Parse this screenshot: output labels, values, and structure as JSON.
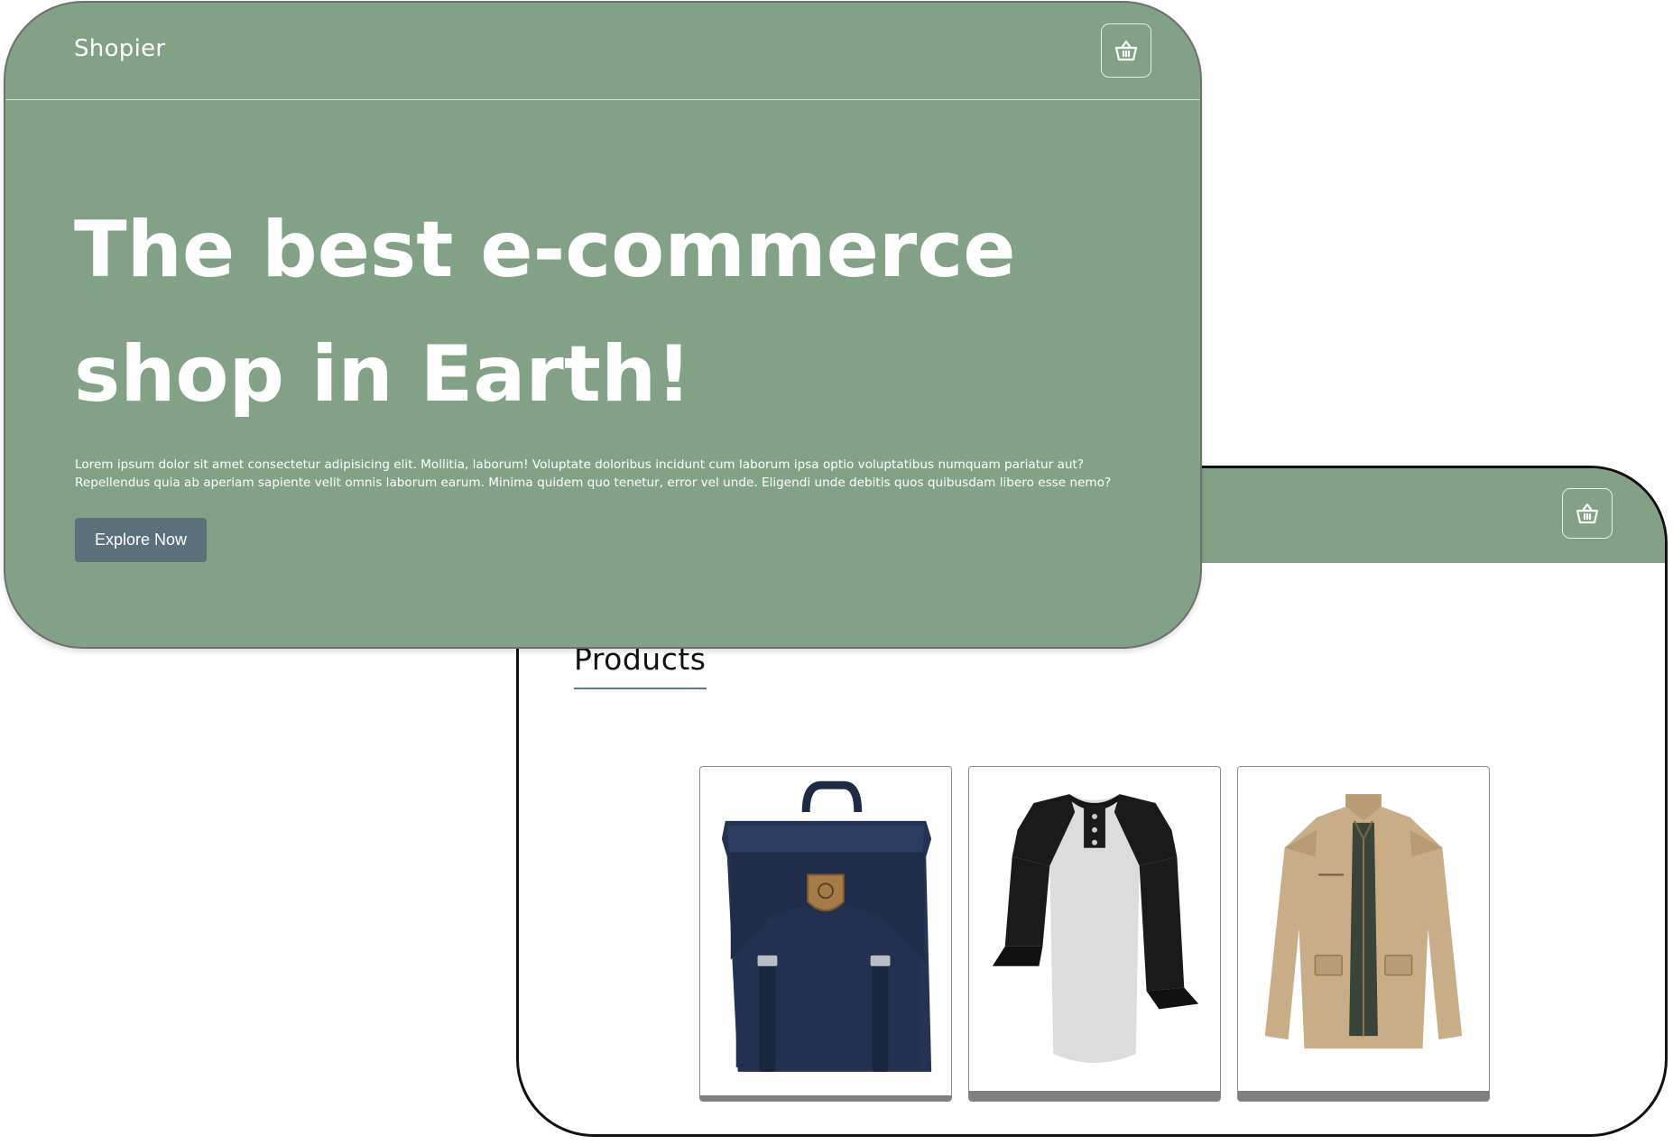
{
  "hero_window": {
    "brand": "Shopier",
    "cart_icon": "basket-icon",
    "title": "The best e-commerce shop in Earth!",
    "description": "Lorem ipsum dolor sit amet consectetur adipisicing elit. Mollitia, laborum! Voluptate doloribus incidunt cum laborum ipsa optio voluptatibus numquam pariatur aut? Repellendus quia ab aperiam sapiente velit omnis laborum earum. Minima quidem quo tenetur, error vel unde. Eligendi unde debitis quos quibusdam libero esse nemo?",
    "cta_label": "Explore Now"
  },
  "products_window": {
    "cart_icon": "basket-icon",
    "heading": "Products",
    "products": [
      {
        "image": "navy-backpack"
      },
      {
        "image": "raglan-henley-shirt"
      },
      {
        "image": "khaki-jacket"
      }
    ]
  },
  "colors": {
    "header_green": "#83a186",
    "button_slate": "#5b707b",
    "heading_underline": "#5d7a86",
    "text_white": "#ffffff"
  }
}
